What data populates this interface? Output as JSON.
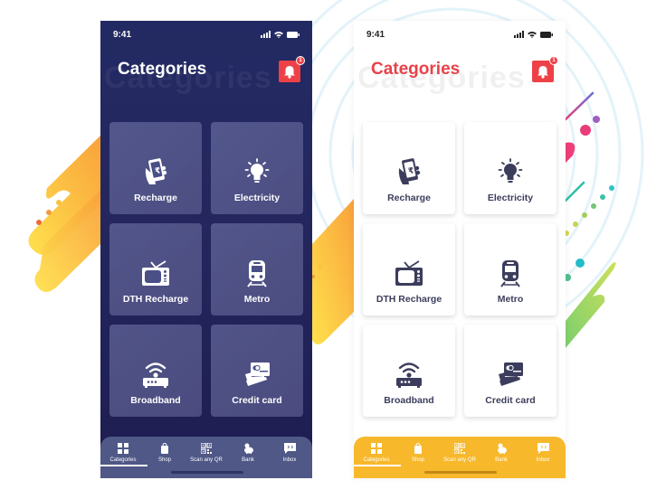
{
  "colors": {
    "dark_bg": "#232a63",
    "accent_red": "#ee4147",
    "title_red": "#e8424a",
    "dark_tabbar": "#4f5886",
    "light_tabbar": "#f7b82c",
    "icon_dark": "#3c3d5c"
  },
  "screens": [
    {
      "theme": "dark",
      "status": {
        "time": "9:41",
        "icons": [
          "signal-icon",
          "wifi-icon",
          "battery-icon"
        ]
      },
      "header": {
        "title": "Categories",
        "ghost_title": "Categories",
        "notification_count": "1"
      },
      "categories": [
        {
          "label": "Recharge",
          "icon": "mobile-recharge-icon"
        },
        {
          "label": "Electricity",
          "icon": "lightbulb-icon"
        },
        {
          "label": "DTH Recharge",
          "icon": "tv-icon"
        },
        {
          "label": "Metro",
          "icon": "train-icon"
        },
        {
          "label": "Broadband",
          "icon": "router-icon"
        },
        {
          "label": "Credit card",
          "icon": "credit-card-icon"
        }
      ],
      "tabs": [
        {
          "label": "Categories",
          "icon": "grid-icon",
          "active": true
        },
        {
          "label": "Shop",
          "icon": "shopping-bag-icon",
          "active": false
        },
        {
          "label": "Scan any QR",
          "icon": "qr-icon",
          "active": false
        },
        {
          "label": "Bank",
          "icon": "piggy-bank-icon",
          "active": false
        },
        {
          "label": "Inbox",
          "icon": "inbox-icon",
          "active": false
        }
      ]
    },
    {
      "theme": "light",
      "status": {
        "time": "9:41",
        "icons": [
          "signal-icon",
          "wifi-icon",
          "battery-icon"
        ]
      },
      "header": {
        "title": "Categories",
        "ghost_title": "Categories",
        "notification_count": "1"
      },
      "categories": [
        {
          "label": "Recharge",
          "icon": "mobile-recharge-icon"
        },
        {
          "label": "Electricity",
          "icon": "lightbulb-icon"
        },
        {
          "label": "DTH Recharge",
          "icon": "tv-icon"
        },
        {
          "label": "Metro",
          "icon": "train-icon"
        },
        {
          "label": "Broadband",
          "icon": "router-icon"
        },
        {
          "label": "Credit card",
          "icon": "credit-card-icon"
        }
      ],
      "tabs": [
        {
          "label": "Categories",
          "icon": "grid-icon",
          "active": true
        },
        {
          "label": "Shop",
          "icon": "shopping-bag-icon",
          "active": false
        },
        {
          "label": "Scan any QR",
          "icon": "qr-icon",
          "active": false
        },
        {
          "label": "Bank",
          "icon": "piggy-bank-icon",
          "active": false
        },
        {
          "label": "Inbox",
          "icon": "inbox-icon",
          "active": false
        }
      ]
    }
  ]
}
